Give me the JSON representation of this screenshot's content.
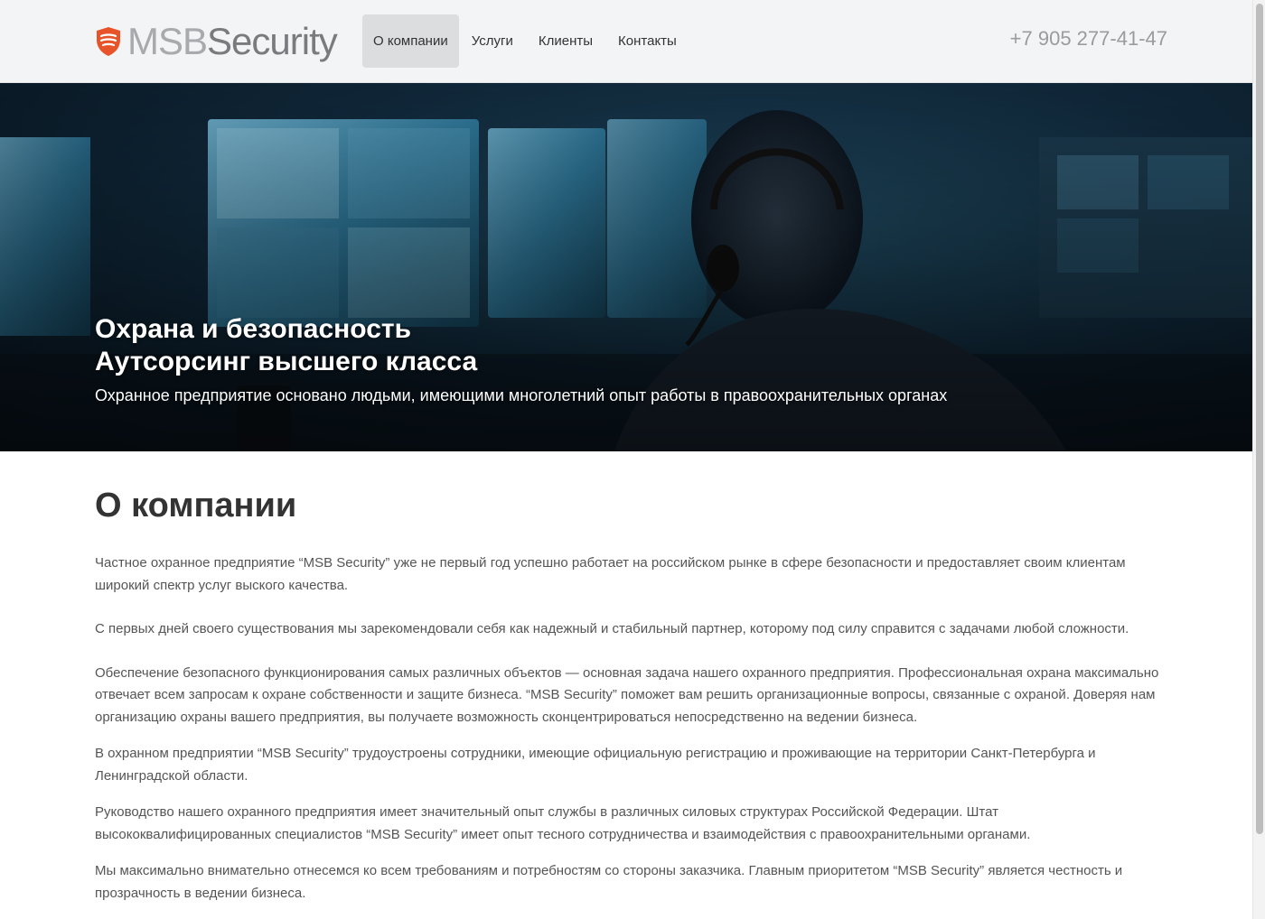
{
  "header": {
    "logo": {
      "part1": "MSB",
      "part2": "Security"
    },
    "nav": [
      {
        "label": "О компании",
        "active": true
      },
      {
        "label": "Услуги",
        "active": false
      },
      {
        "label": "Клиенты",
        "active": false
      },
      {
        "label": "Контакты",
        "active": false
      }
    ],
    "phone": "+7 905 277-41-47"
  },
  "hero": {
    "title_line1": "Охрана и безопасность",
    "title_line2": "Аутсорсинг высшего класса",
    "subtitle": "Охранное предприятие основано людьми, имеющими многолетний опыт работы в правоохранительных органах"
  },
  "about": {
    "title": "О компании",
    "paragraphs": [
      "Частное охранное предприятие “MSB Security” уже не первый год успешно работает на российском рынке в сфере безопасности и предоставляет своим клиентам широкий спектр услуг выского качества.",
      "С первых дней своего существования мы зарекомендовали себя как надежный и стабильный партнер, которому под силу справится с задачами любой сложности.",
      "Обеспечение безопасного функционирования самых различных объектов — основная задача нашего охранного предприятия. Профессиональная охрана максимально отвечает всем запросам к охране собственности и защите бизнеса. “MSB Security” поможет вам решить организационные вопросы, связанные с охраной. Доверяя нам организацию охраны вашего предприятия, вы получаете возможность сконцентрироваться непосредственно на ведении бизнеса.",
      "В охранном предприятии “MSB Security” трудоустроены сотрудники, имеющие официальную регистрацию и проживающие на территории Санкт-Петербурга и Ленинградской области.",
      "Руководство нашего охранного предприятия имеет значительный опыт службы в различных силовых структурах Российской Федерации. Штат высококвалифицированных специалистов “MSB Security” имеет опыт тесного сотрудничества и взаимодействия с правоохранительными органами.",
      "Мы максимально внимательно отнесемся ко всем требованиям и потребностям со стороны заказчика. Главным приоритетом “MSB Security” является честность и прозрачность в ведении бизнеса."
    ]
  },
  "colors": {
    "brand_orange": "#e8542a",
    "header_bg": "#f3f4f6",
    "nav_active_bg": "#dcdddf"
  }
}
